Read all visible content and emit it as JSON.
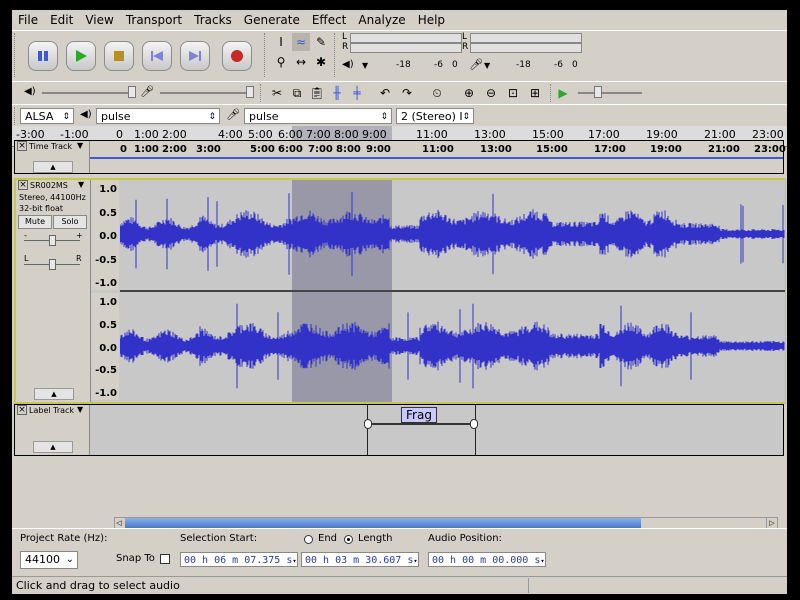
{
  "menu": [
    "File",
    "Edit",
    "View",
    "Transport",
    "Tracks",
    "Generate",
    "Effect",
    "Analyze",
    "Help"
  ],
  "meters": {
    "ticks": [
      "-18",
      "-6",
      "0"
    ],
    "record_ticks": [
      "-18",
      "-6",
      "0"
    ],
    "L": "L",
    "R": "R"
  },
  "device": {
    "host": "ALSA",
    "playback": "pulse",
    "recording": "pulse",
    "channels": "2 (Stereo) I"
  },
  "ruler": [
    "-3:00",
    "-1:00",
    "0",
    "1:00",
    "2:00",
    "4:00",
    "5:00",
    "6:00",
    "7:00",
    "8:00",
    "9:00",
    "11:00",
    "13:00",
    "15:00",
    "17:00",
    "19:00",
    "21:00",
    "23:00"
  ],
  "time_track": {
    "name": "Time Track",
    "ticks": [
      "0",
      "1:00",
      "2:00",
      "3:00",
      "5:00",
      "6:00",
      "7:00",
      "8:00",
      "9:00",
      "11:00",
      "13:00",
      "15:00",
      "17:00",
      "19:00",
      "21:00",
      "23:00"
    ]
  },
  "audio_track": {
    "name": "SR002MS",
    "info1": "Stereo, 44100Hz",
    "info2": "32-bit float",
    "mute": "Mute",
    "solo": "Solo",
    "gain_minus": "-",
    "gain_plus": "+",
    "pan_l": "L",
    "pan_r": "R",
    "scale": [
      "1.0",
      "0.5",
      "0.0",
      "-0.5",
      "-1.0"
    ]
  },
  "label_track": {
    "name": "Label Track",
    "label": "Frag"
  },
  "bottom": {
    "project_rate_label": "Project Rate (Hz):",
    "project_rate": "44100",
    "snap_to": "Snap To",
    "selection_start_label": "Selection Start:",
    "end_label": "End",
    "length_label": "Length",
    "audio_position_label": "Audio Position:",
    "selection_start": "00 h 06 m 07.375 s",
    "selection_length": "00 h 03 m 30.607 s",
    "audio_position": "00 h 00 m 00.000 s"
  },
  "status": "Click and drag to select audio",
  "colors": {
    "wave": "#3232c8",
    "selection": "#9898a8",
    "frame": "#000000",
    "label_bg": "#c8c8ff"
  }
}
